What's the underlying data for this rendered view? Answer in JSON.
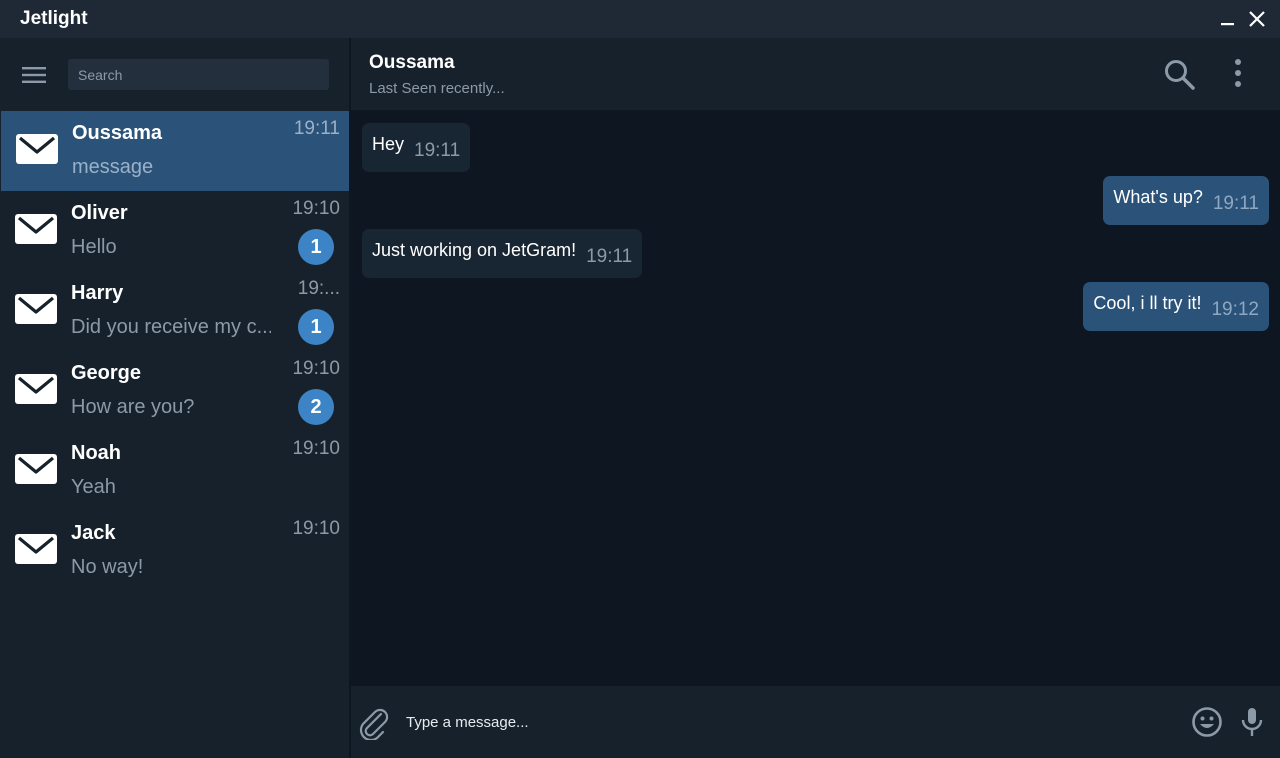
{
  "window": {
    "title": "Jetlight"
  },
  "sidebar": {
    "search_placeholder": "Search",
    "chats": [
      {
        "name": "Oussama",
        "preview": "message",
        "time": "19:11",
        "unread": null,
        "active": true
      },
      {
        "name": "Oliver",
        "preview": "Hello",
        "time": "19:10",
        "unread": "1",
        "active": false
      },
      {
        "name": "Harry",
        "preview": "Did you receive my c...",
        "time": "19:...",
        "unread": "1",
        "active": false
      },
      {
        "name": "George",
        "preview": "How are you?",
        "time": "19:10",
        "unread": "2",
        "active": false
      },
      {
        "name": "Noah",
        "preview": "Yeah",
        "time": "19:10",
        "unread": null,
        "active": false
      },
      {
        "name": "Jack",
        "preview": "No way!",
        "time": "19:10",
        "unread": null,
        "active": false
      }
    ]
  },
  "chat": {
    "peer_name": "Oussama",
    "peer_status": "Last Seen recently...",
    "messages": [
      {
        "direction": "in",
        "text": "Hey",
        "time": "19:11"
      },
      {
        "direction": "out",
        "text": "What's up?",
        "time": "19:11"
      },
      {
        "direction": "in",
        "text": "Just working on JetGram!",
        "time": "19:11"
      },
      {
        "direction": "out",
        "text": "Cool, i ll try it!",
        "time": "19:12"
      }
    ],
    "composer_placeholder": "Type a message..."
  },
  "icons": {
    "minimize": "minimize-icon",
    "close": "close-icon",
    "menu": "hamburger-menu-icon",
    "avatar": "envelope-icon",
    "search": "search-icon",
    "more": "more-vertical-icon",
    "attach": "paperclip-icon",
    "emoji": "smiley-icon",
    "mic": "microphone-icon"
  },
  "colors": {
    "background": "#0e1621",
    "panel": "#17212b",
    "titlebar": "#1f2936",
    "accent": "#2b5278",
    "badge": "#3d84c6",
    "incoming_bubble": "#182533",
    "muted_text": "#8c9aa8"
  }
}
